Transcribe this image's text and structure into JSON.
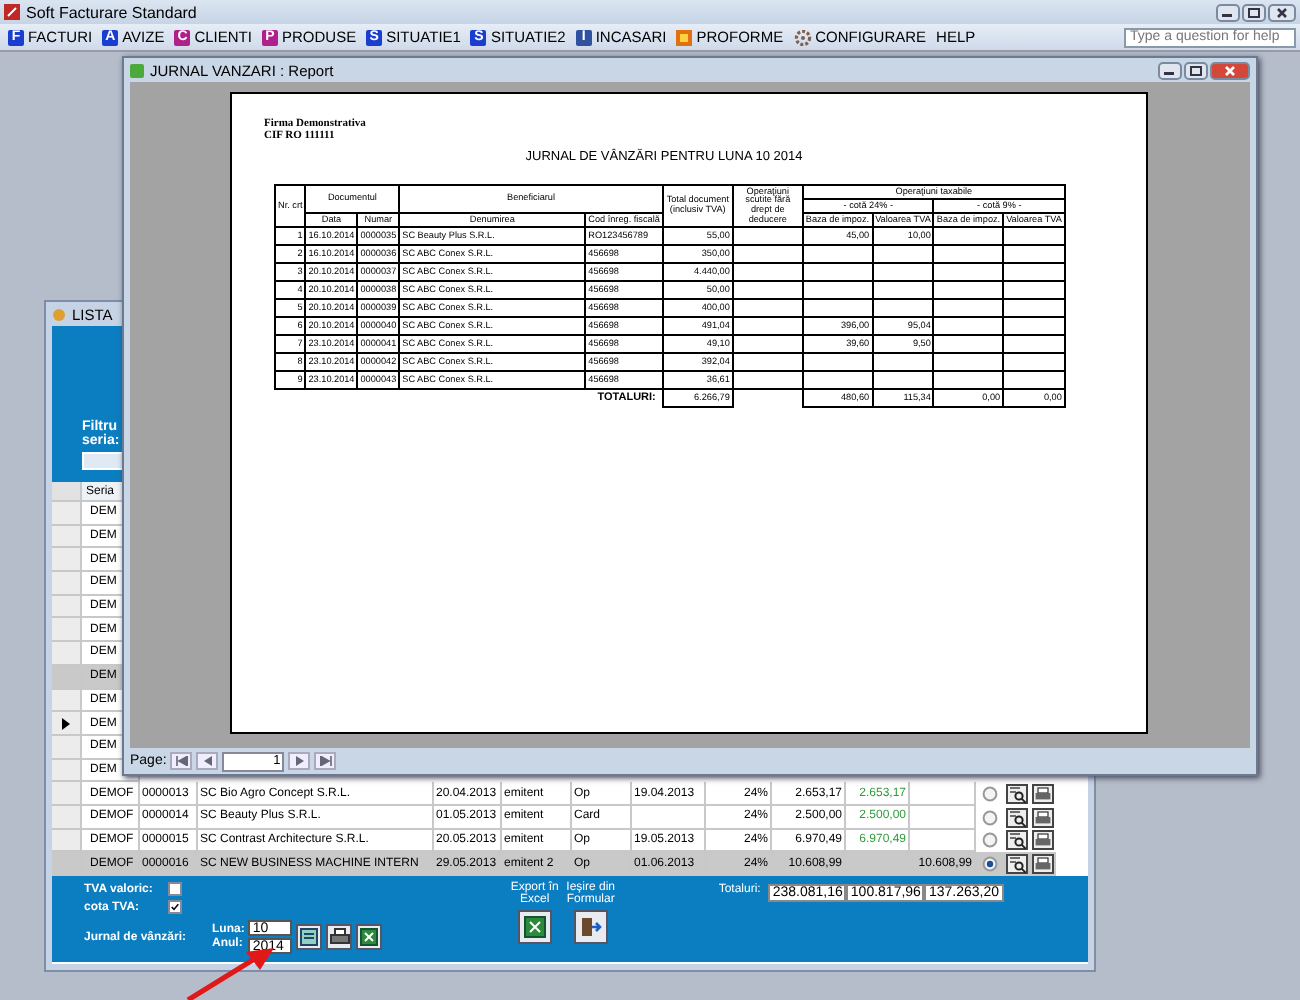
{
  "app": {
    "title": "Soft Facturare Standard"
  },
  "menu": [
    {
      "label": "FACTURI",
      "kind": "letter",
      "icon_text": "F",
      "color": "#1a3fd0"
    },
    {
      "label": "AVIZE",
      "kind": "letter",
      "icon_text": "A",
      "color": "#1a3fd0"
    },
    {
      "label": "CLIENTI",
      "kind": "letter",
      "icon_text": "C",
      "color": "#b0208a"
    },
    {
      "label": "PRODUSE",
      "kind": "letter",
      "icon_text": "P",
      "color": "#b0208a"
    },
    {
      "label": "SITUATIE1",
      "kind": "letter",
      "icon_text": "S",
      "color": "#1a3fd0"
    },
    {
      "label": "SITUATIE2",
      "kind": "letter",
      "icon_text": "S",
      "color": "#1a3fd0"
    },
    {
      "label": "INCASARI",
      "kind": "letter",
      "icon_text": "I",
      "color": "#3050a0"
    },
    {
      "label": "PROFORME",
      "kind": "tile",
      "color": "#e07010"
    },
    {
      "label": "CONFIGURARE",
      "kind": "gear",
      "color": "#806050"
    },
    {
      "label": "HELP",
      "kind": "plain"
    }
  ],
  "help_search": {
    "placeholder": "Type a question for help"
  },
  "list_window": {
    "title": "LISTA",
    "filter_label": "Filtru seria:",
    "column": "Seria",
    "rows": [
      {
        "seria": "DEM",
        "selected": false,
        "current": false
      },
      {
        "seria": "DEM",
        "selected": false,
        "current": false
      },
      {
        "seria": "DEM",
        "selected": false,
        "current": false
      },
      {
        "seria": "DEM",
        "selected": false,
        "current": false
      },
      {
        "seria": "DEM",
        "selected": false,
        "current": false
      },
      {
        "seria": "DEM",
        "selected": false,
        "current": false
      },
      {
        "seria": "DEM",
        "selected": false,
        "current": false
      },
      {
        "seria": "DEM",
        "selected": true,
        "current": false
      },
      {
        "seria": "DEM",
        "selected": false,
        "current": false
      },
      {
        "seria": "DEM",
        "selected": false,
        "current": true
      },
      {
        "seria": "DEM",
        "selected": false,
        "current": false
      },
      {
        "seria": "DEM",
        "selected": false,
        "current": false
      },
      {
        "seria": "DEMOF",
        "selected": false,
        "current": false,
        "checked": false,
        "cells": [
          "0000013",
          "SC Bio Agro Concept S.R.L.",
          "20.04.2013",
          "emitent",
          "Op",
          "19.04.2013",
          "24%",
          "2.653,17",
          "2.653,17",
          ""
        ]
      },
      {
        "seria": "DEMOF",
        "selected": false,
        "current": false,
        "checked": false,
        "cells": [
          "0000014",
          "SC Beauty Plus S.R.L.",
          "01.05.2013",
          "emitent",
          "Card",
          "",
          "24%",
          "2.500,00",
          "2.500,00",
          ""
        ]
      },
      {
        "seria": "DEMOF",
        "selected": false,
        "current": false,
        "checked": false,
        "cells": [
          "0000015",
          "SC Contrast Architecture S.R.L.",
          "20.05.2013",
          "emitent",
          "Op",
          "19.05.2013",
          "24%",
          "6.970,49",
          "6.970,49",
          ""
        ]
      },
      {
        "seria": "DEMOF",
        "selected": true,
        "current": false,
        "checked": true,
        "cells": [
          "0000016",
          "SC NEW BUSINESS MACHINE INTERN",
          "29.05.2013",
          "emitent 2",
          "Op",
          "01.06.2013",
          "24%",
          "10.608,99",
          "",
          "10.608,99"
        ]
      }
    ],
    "footer": {
      "checkboxes": [
        {
          "label": "TVA valoric:",
          "checked": false
        },
        {
          "label": "cota TVA:",
          "checked": true
        }
      ],
      "journal": {
        "label": "Jurnal de vânzări:",
        "month_label": "Luna:",
        "month": "10",
        "year_label": "Anul:",
        "year": "2014"
      },
      "actions": [
        {
          "label": "Export în Excel",
          "kind": "excel"
        },
        {
          "label": "Ieşire din Formular",
          "kind": "exit"
        }
      ],
      "totals_label": "Totaluri:",
      "totals": [
        "238.081,16",
        "100.817,96",
        "137.263,20"
      ]
    }
  },
  "report_window": {
    "title": "JURNAL VANZARI : Report",
    "company": "Firma Demonstrativa",
    "cif": "CIF  RO 111111",
    "heading": "JURNAL DE VÂNZĂRI PENTRU LUNA  10 2014",
    "header": {
      "nr": "Nr. crt",
      "document": "Documentul",
      "data": "Data",
      "numar": "Numar",
      "beneficiar": "Beneficiarul",
      "denumirea": "Denumirea",
      "cod": "Cod înreg. fiscală",
      "total": "Total document (inclusiv TVA)",
      "scutite": "Operaţiuni scutite fără drept de deducere",
      "taxabile": "Operaţiuni taxabile",
      "cote": [
        {
          "label": "- cotă 24% -",
          "columns": [
            "Baza de impoz.",
            "Valoarea TVA"
          ]
        },
        {
          "label": "- cotă 9% -",
          "columns": [
            "Baza de impoz.",
            "Valoarea TVA"
          ]
        }
      ]
    },
    "rows": [
      [
        "1",
        "16.10.2014",
        "0000035",
        "SC Beauty Plus S.R.L.",
        "RO123456789",
        "55,00",
        "",
        "45,00",
        "10,00",
        "",
        ""
      ],
      [
        "2",
        "16.10.2014",
        "0000036",
        "SC ABC Conex S.R.L.",
        "456698",
        "350,00",
        "",
        "",
        "",
        "",
        ""
      ],
      [
        "3",
        "20.10.2014",
        "0000037",
        "SC ABC Conex S.R.L.",
        "456698",
        "4.440,00",
        "",
        "",
        "",
        "",
        ""
      ],
      [
        "4",
        "20.10.2014",
        "0000038",
        "SC ABC Conex S.R.L.",
        "456698",
        "50,00",
        "",
        "",
        "",
        "",
        ""
      ],
      [
        "5",
        "20.10.2014",
        "0000039",
        "SC ABC Conex S.R.L.",
        "456698",
        "400,00",
        "",
        "",
        "",
        "",
        ""
      ],
      [
        "6",
        "20.10.2014",
        "0000040",
        "SC ABC Conex S.R.L.",
        "456698",
        "491,04",
        "",
        "396,00",
        "95,04",
        "",
        ""
      ],
      [
        "7",
        "23.10.2014",
        "0000041",
        "SC ABC Conex S.R.L.",
        "456698",
        "49,10",
        "",
        "39,60",
        "9,50",
        "",
        ""
      ],
      [
        "8",
        "23.10.2014",
        "0000042",
        "SC ABC Conex S.R.L.",
        "456698",
        "392,04",
        "",
        "",
        "",
        "",
        ""
      ],
      [
        "9",
        "23.10.2014",
        "0000043",
        "SC ABC Conex S.R.L.",
        "456698",
        "36,61",
        "",
        "",
        "",
        "",
        ""
      ]
    ],
    "totals_label": "TOTALURI:",
    "totals": [
      "6.266,79",
      "480,60",
      "115,34",
      "0,00",
      "0,00"
    ],
    "pager": {
      "label": "Page:",
      "page": "1"
    }
  }
}
